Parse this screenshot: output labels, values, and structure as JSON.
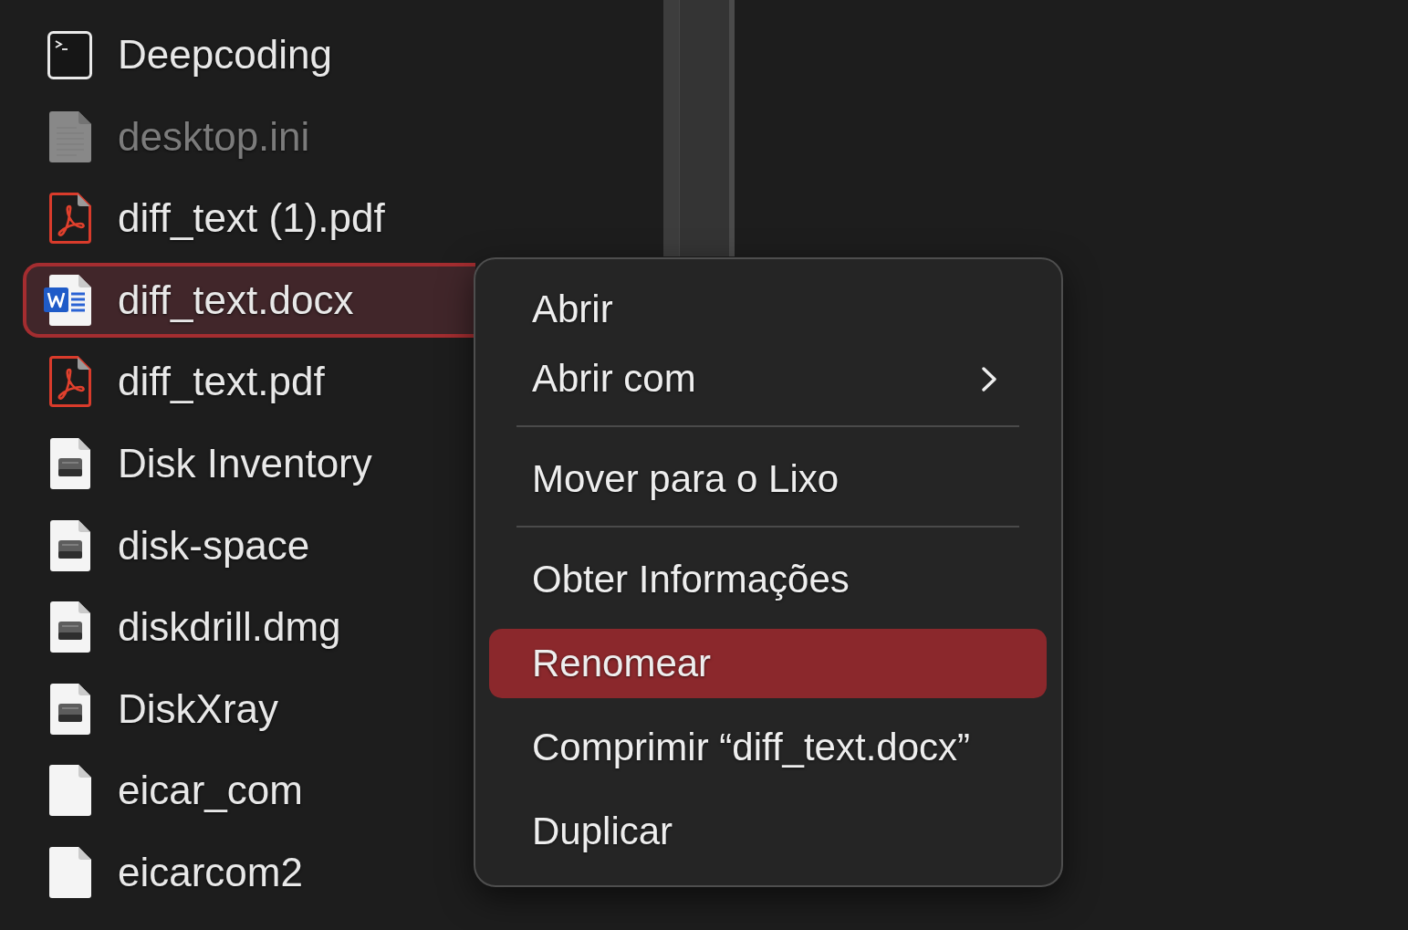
{
  "files": [
    {
      "name": "Deepcoding",
      "kind": "terminal",
      "dimmed": false,
      "selected": false
    },
    {
      "name": "desktop.ini",
      "kind": "text_document",
      "dimmed": true,
      "selected": false
    },
    {
      "name": "diff_text (1).pdf",
      "kind": "pdf",
      "dimmed": false,
      "selected": false
    },
    {
      "name": "diff_text.docx",
      "kind": "word",
      "dimmed": false,
      "selected": true
    },
    {
      "name": "diff_text.pdf",
      "kind": "pdf",
      "dimmed": false,
      "selected": false
    },
    {
      "name": "Disk Inventory",
      "kind": "disk_image",
      "dimmed": false,
      "selected": false
    },
    {
      "name": "disk-space",
      "kind": "disk_image",
      "dimmed": false,
      "selected": false
    },
    {
      "name": "diskdrill.dmg",
      "kind": "disk_image",
      "dimmed": false,
      "selected": false
    },
    {
      "name": "DiskXray",
      "kind": "disk_image",
      "dimmed": false,
      "selected": false
    },
    {
      "name": "eicar_com",
      "kind": "blank_document",
      "dimmed": false,
      "selected": false
    },
    {
      "name": "eicarcom2",
      "kind": "blank_document",
      "dimmed": false,
      "selected": false
    }
  ],
  "context_menu": {
    "groups": [
      {
        "items": [
          {
            "label": "Abrir",
            "submenu": false,
            "selected": false
          },
          {
            "label": "Abrir com",
            "submenu": true,
            "selected": false
          }
        ]
      },
      {
        "items": [
          {
            "label": "Mover para o Lixo",
            "submenu": false,
            "selected": false
          }
        ]
      },
      {
        "items": [
          {
            "label": "Obter Informações",
            "submenu": false,
            "selected": false
          },
          {
            "label": "Renomear",
            "submenu": false,
            "selected": true
          },
          {
            "label": "Comprimir “diff_text.docx”",
            "submenu": false,
            "selected": false
          },
          {
            "label": "Duplicar",
            "submenu": false,
            "selected": false
          }
        ]
      }
    ]
  }
}
